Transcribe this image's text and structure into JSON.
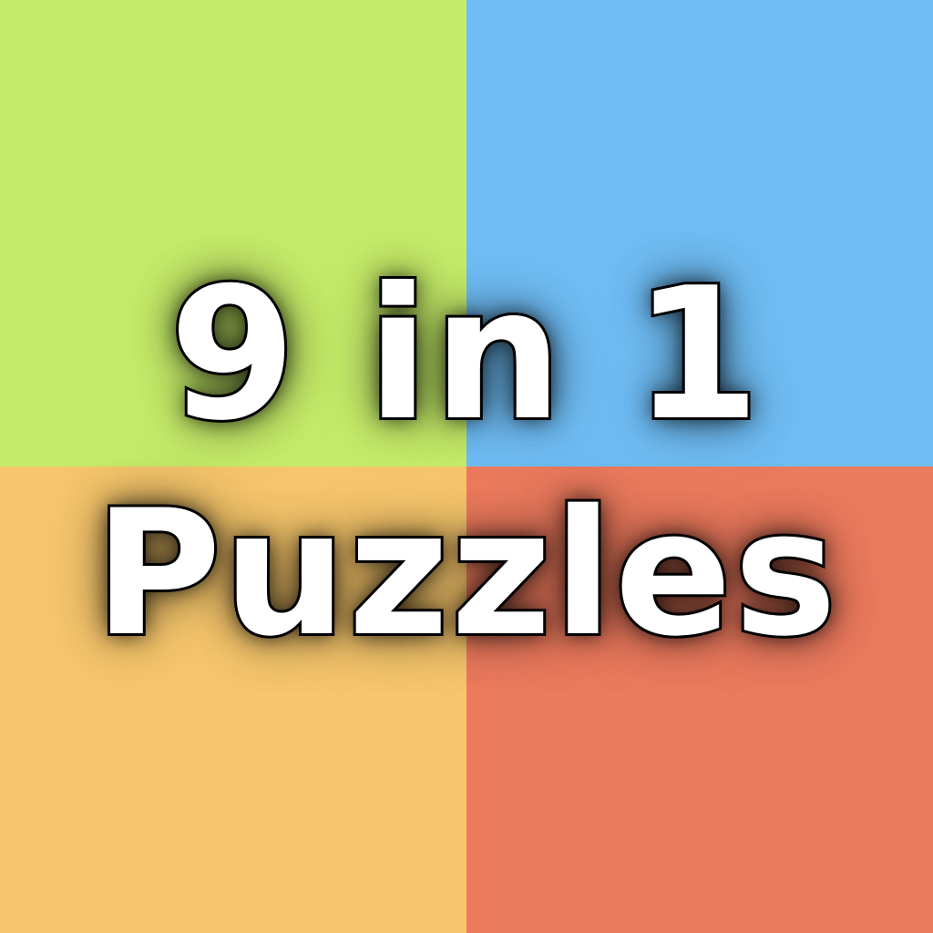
{
  "quadrants": {
    "top_left": "#c5ec69",
    "top_right": "#6fbdf5",
    "bottom_left": "#f6c66c",
    "bottom_right": "#ec7a5e"
  },
  "title": {
    "line1": "9 in 1",
    "line2": "Puzzles"
  }
}
